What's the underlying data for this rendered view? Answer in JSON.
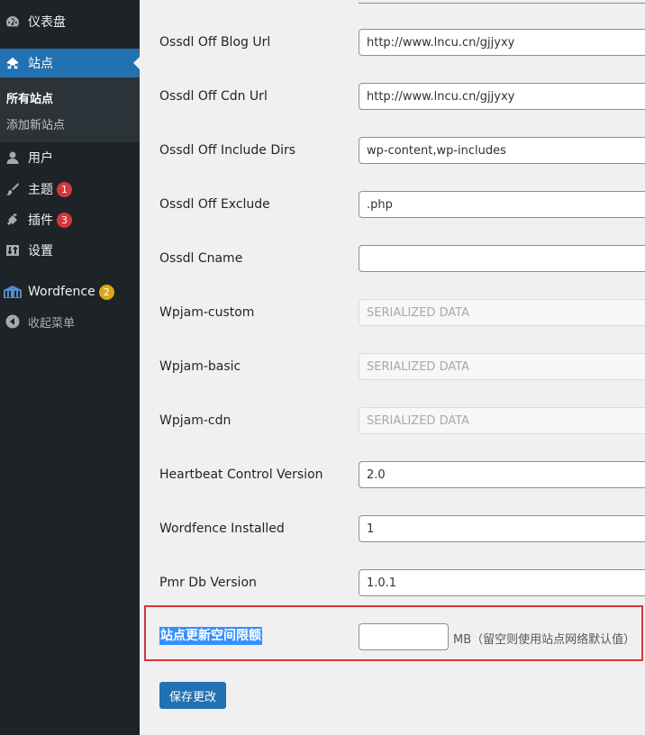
{
  "sidebar": {
    "dashboard": "仪表盘",
    "sites": "站点",
    "sites_submenu": [
      "所有站点",
      "添加新站点"
    ],
    "users": "用户",
    "themes": "主题",
    "themes_badge": "1",
    "plugins": "插件",
    "plugins_badge": "3",
    "settings": "设置",
    "wordfence": "Wordfence",
    "wordfence_badge": "2",
    "collapse": "收起菜单"
  },
  "form": {
    "rows": [
      {
        "label": "Ossdl Off Blog Url",
        "value": "http://www.lncu.cn/gjjyxy",
        "disabled": false
      },
      {
        "label": "Ossdl Off Cdn Url",
        "value": "http://www.lncu.cn/gjjyxy",
        "disabled": false
      },
      {
        "label": "Ossdl Off Include Dirs",
        "value": "wp-content,wp-includes",
        "disabled": false
      },
      {
        "label": "Ossdl Off Exclude",
        "value": ".php",
        "disabled": false
      },
      {
        "label": "Ossdl Cname",
        "value": "",
        "disabled": false
      },
      {
        "label": "Wpjam-custom",
        "value": "SERIALIZED DATA",
        "disabled": true
      },
      {
        "label": "Wpjam-basic",
        "value": "SERIALIZED DATA",
        "disabled": true
      },
      {
        "label": "Wpjam-cdn",
        "value": "SERIALIZED DATA",
        "disabled": true
      },
      {
        "label": "Heartbeat Control Version",
        "value": "2.0",
        "disabled": false
      },
      {
        "label": "Wordfence Installed",
        "value": "1",
        "disabled": false
      },
      {
        "label": "Pmr Db Version",
        "value": "1.0.1",
        "disabled": false
      }
    ],
    "quota_label": "站点更新空间限额",
    "quota_value": "",
    "quota_help": "MB（留空则使用站点网络默认值）",
    "save_button": "保存更改"
  },
  "colors": {
    "sidebar_bg": "#1d2327",
    "active_blue": "#2271b1",
    "badge_red": "#d63638",
    "badge_yellow": "#dba617",
    "highlight_border": "#d63638"
  },
  "icons": [
    "dashboard-icon",
    "sites-icon",
    "users-icon",
    "themes-icon",
    "plugins-icon",
    "settings-icon",
    "wordfence-icon",
    "collapse-icon"
  ]
}
